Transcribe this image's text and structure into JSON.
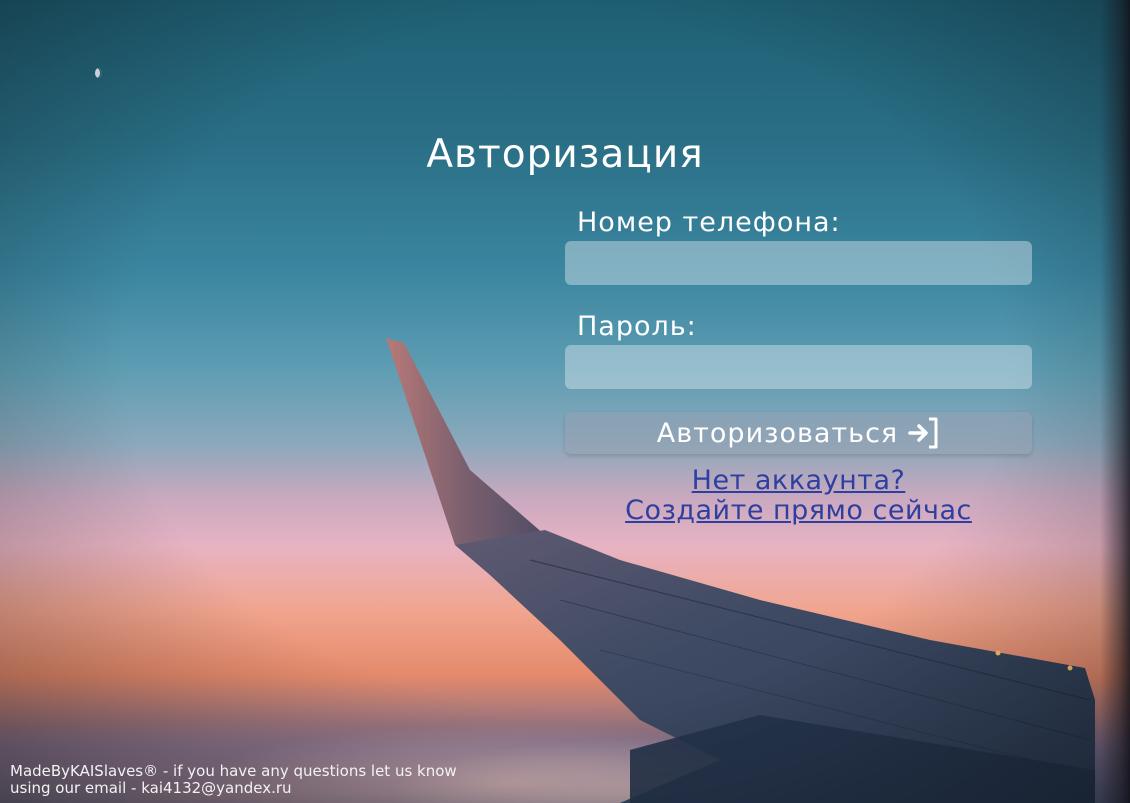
{
  "page": {
    "title": "Авторизация"
  },
  "form": {
    "phone_label": "Номер телефона:",
    "phone_value": "",
    "password_label": "Пароль:",
    "password_value": "",
    "submit_label": "Авторизоваться",
    "register_line1": "Нет аккаунта?",
    "register_line2": "Создайте прямо сейчас"
  },
  "footer": {
    "line1": "MadeByKAISlaves® - if you have any questions let us know",
    "line2": "using our email - kai4132@yandex.ru"
  },
  "icons": {
    "submit_icon": "login-icon",
    "moon": "moon-icon"
  },
  "colors": {
    "link": "#2e3fa0",
    "text": "#ffffff"
  }
}
